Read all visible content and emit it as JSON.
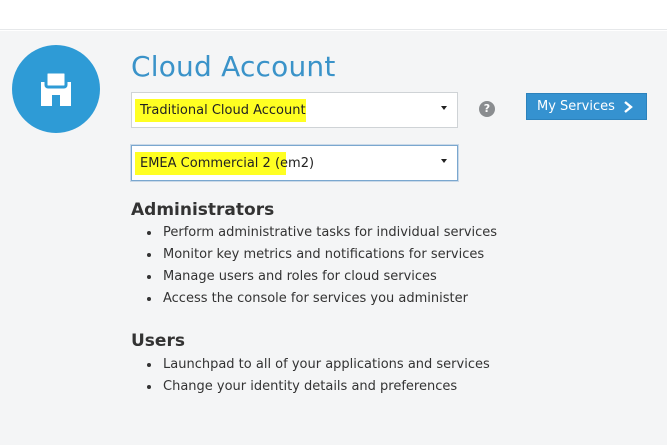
{
  "page": {
    "title": "Cloud Account",
    "avatar_icon": "user-badge-icon",
    "accent_color": "#2e9bd6",
    "highlight_color": "#ffff22"
  },
  "account_type_select": {
    "value": "Traditional Cloud Account"
  },
  "data_region_select": {
    "value": "EMEA Commercial 2 (em2)"
  },
  "help": {
    "icon": "help-icon",
    "glyph": "?"
  },
  "my_services_button": {
    "label": "My Services",
    "icon": "chevron-right-icon"
  },
  "administrators": {
    "heading": "Administrators",
    "items": [
      "Perform administrative tasks for individual services",
      "Monitor key metrics and notifications for services",
      "Manage users and roles for cloud services",
      "Access the console for services you administer"
    ]
  },
  "users": {
    "heading": "Users",
    "items": [
      "Launchpad to all of your applications and services",
      "Change your identity details and preferences"
    ]
  }
}
